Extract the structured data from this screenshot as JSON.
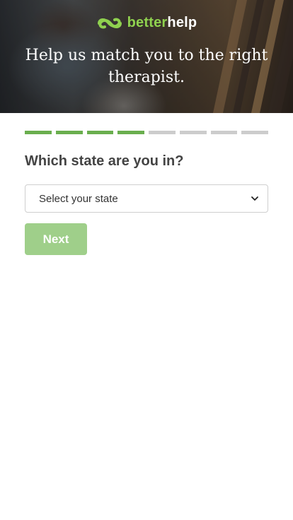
{
  "brand": {
    "better": "better",
    "help": "help",
    "logo_color": "#8fd14f"
  },
  "hero": {
    "title": "Help us match you to the right therapist."
  },
  "progress": {
    "completed_steps": 4,
    "total_steps": 8,
    "done_color": "#6aae4e",
    "todo_color": "#cccccc"
  },
  "question": {
    "text": "Which state are you in?"
  },
  "state_select": {
    "value": "Select your state"
  },
  "next_button": {
    "label": "Next",
    "color": "#9fcf8a",
    "state": "disabled"
  },
  "icons": {
    "logo": "betterhelp-logo-icon",
    "dropdown": "chevron-down-icon"
  }
}
